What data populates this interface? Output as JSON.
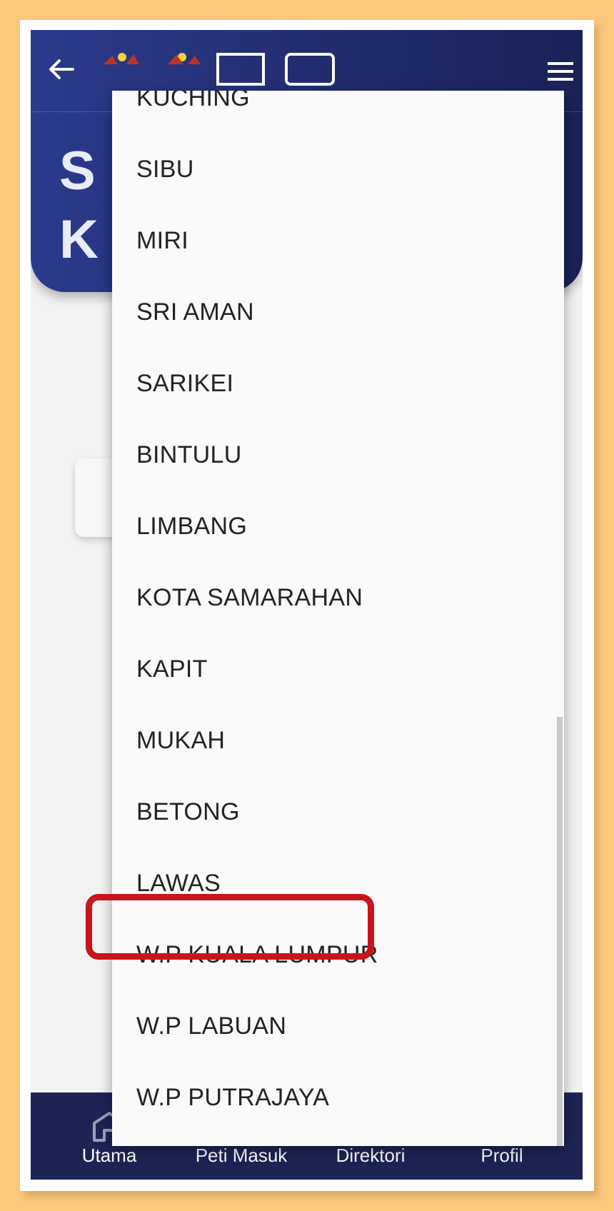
{
  "screen": {
    "title_fragment": [
      "S",
      "K"
    ]
  },
  "bottom_nav": {
    "items": [
      {
        "label": "Utama",
        "icon": "home-icon"
      },
      {
        "label": "Peti Masuk",
        "icon": "mail-icon"
      },
      {
        "label": "Direktori",
        "icon": "location-pin-icon"
      },
      {
        "label": "Profil",
        "icon": "user-icon"
      }
    ]
  },
  "dropdown": {
    "options": [
      "KUCHING",
      "SIBU",
      "MIRI",
      "SRI AMAN",
      "SARIKEI",
      "BINTULU",
      "LIMBANG",
      "KOTA SAMARAHAN",
      "KAPIT",
      "MUKAH",
      "BETONG",
      "LAWAS",
      "W.P KUALA LUMPUR",
      "W.P LABUAN",
      "W.P PUTRAJAYA"
    ],
    "highlighted": "W.P KUALA LUMPUR"
  },
  "colors": {
    "header": "#26337a",
    "bottom_nav": "#1d2454",
    "highlight": "#c8141a",
    "page_bg": "#fcc87d"
  }
}
